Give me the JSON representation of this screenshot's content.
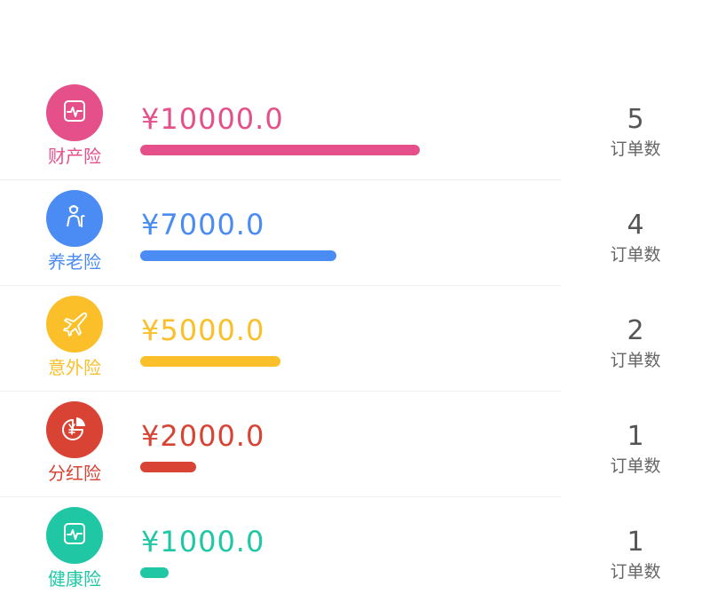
{
  "insurance_list": [
    {
      "name": "财产险",
      "amount": "¥10000.0",
      "order_count": "5",
      "count_label": "订单数",
      "color": "#e5508a",
      "icon": "health-monitor-icon",
      "amount_share": 1.0
    },
    {
      "name": "养老险",
      "amount": "¥7000.0",
      "order_count": "4",
      "count_label": "订单数",
      "color": "#4a8cf3",
      "icon": "elderly-person-icon",
      "amount_share": 0.7
    },
    {
      "name": "意外险",
      "amount": "¥5000.0",
      "order_count": "2",
      "count_label": "订单数",
      "color": "#fbbf2a",
      "icon": "airplane-icon",
      "amount_share": 0.5
    },
    {
      "name": "分红险",
      "amount": "¥2000.0",
      "order_count": "1",
      "count_label": "订单数",
      "color": "#d84334",
      "icon": "yuan-pie-icon",
      "amount_share": 0.2
    },
    {
      "name": "健康险",
      "amount": "¥1000.0",
      "order_count": "1",
      "count_label": "订单数",
      "color": "#1fc7a5",
      "icon": "health-monitor-icon",
      "amount_share": 0.1
    }
  ]
}
